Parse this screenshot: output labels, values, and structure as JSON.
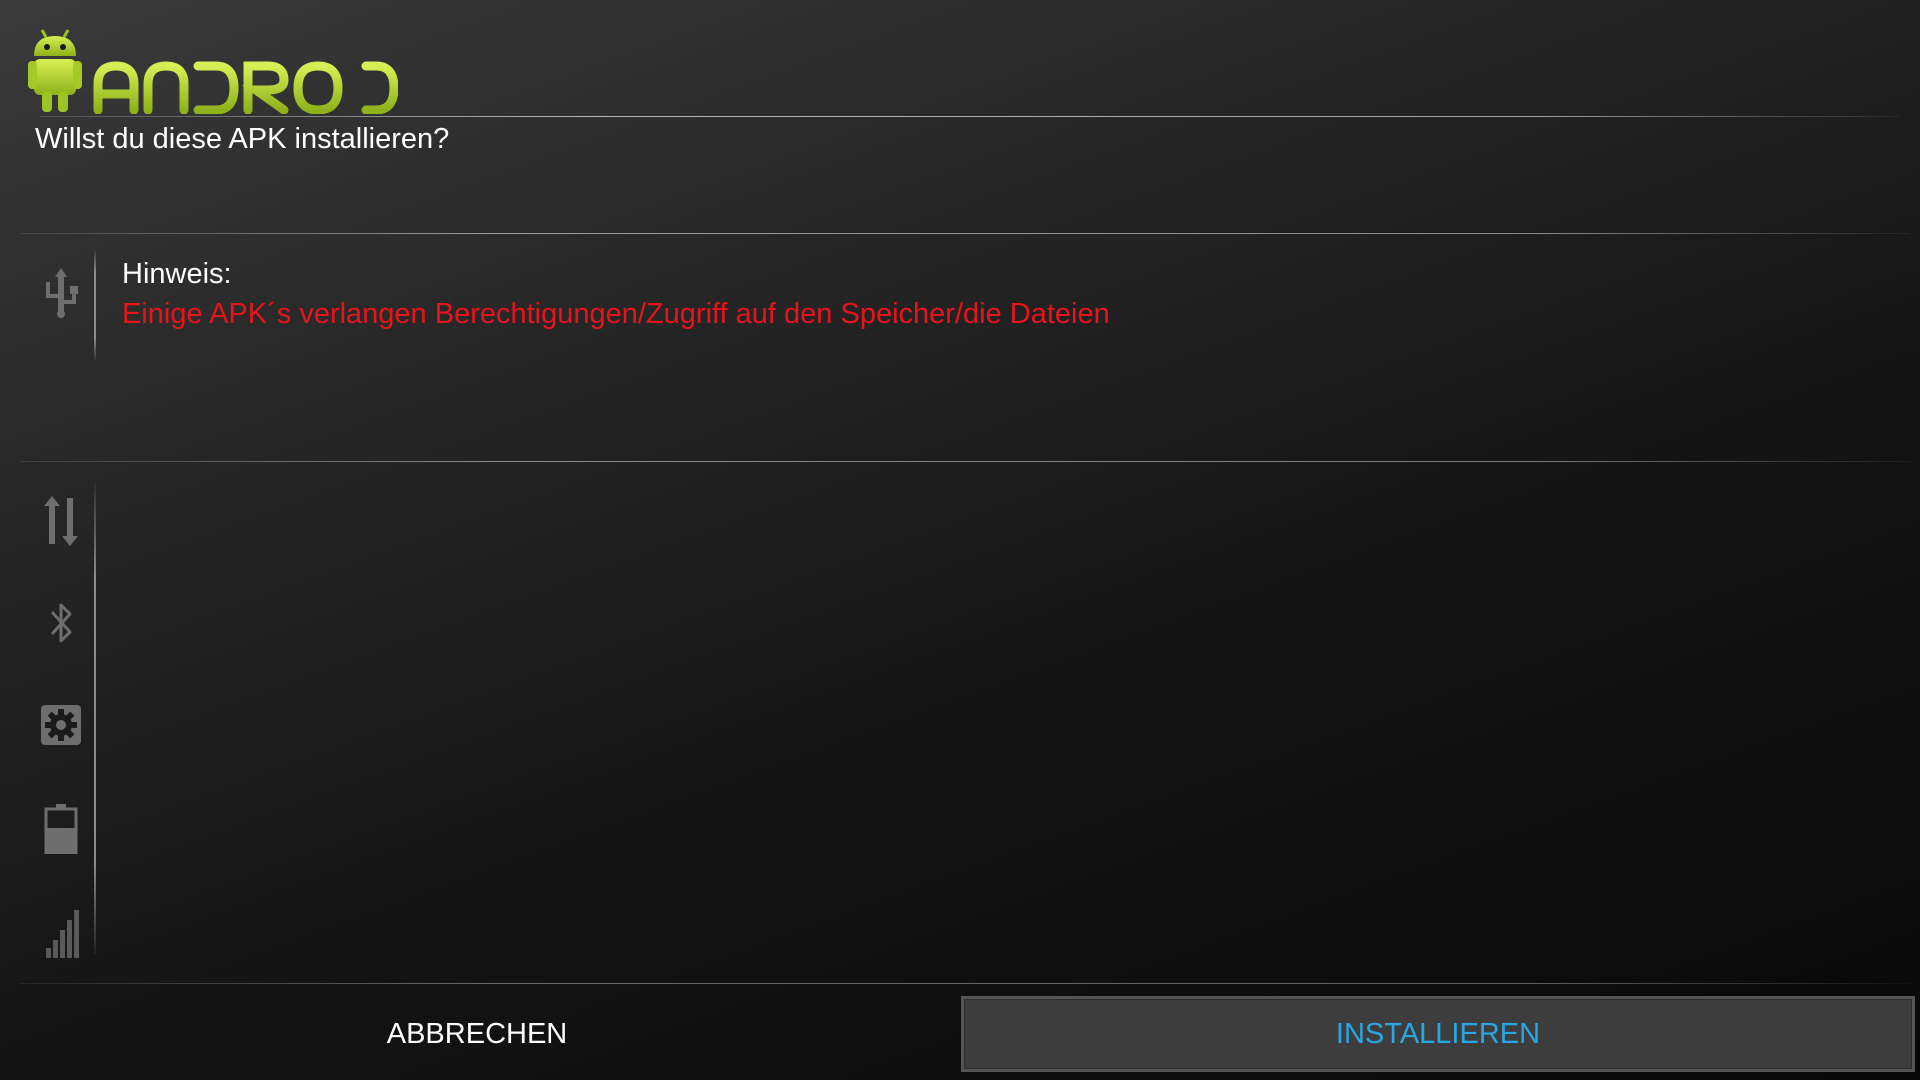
{
  "header": {
    "logo_text": "ANDROID",
    "question": "Willst du diese APK installieren?"
  },
  "notice": {
    "label": "Hinweis:",
    "message": "Einige APK´s verlangen Berechtigungen/Zugriff auf den Speicher/die Dateien"
  },
  "sidebar_icons": [
    "usb-icon",
    "data-transfer-icon",
    "bluetooth-icon",
    "settings-icon",
    "battery-icon",
    "signal-icon"
  ],
  "buttons": {
    "cancel": "ABBRECHEN",
    "install": "INSTALLIEREN"
  },
  "colors": {
    "logo_green": "#b7d631",
    "warning_red": "#e8141b",
    "install_blue": "#29a7e3"
  }
}
